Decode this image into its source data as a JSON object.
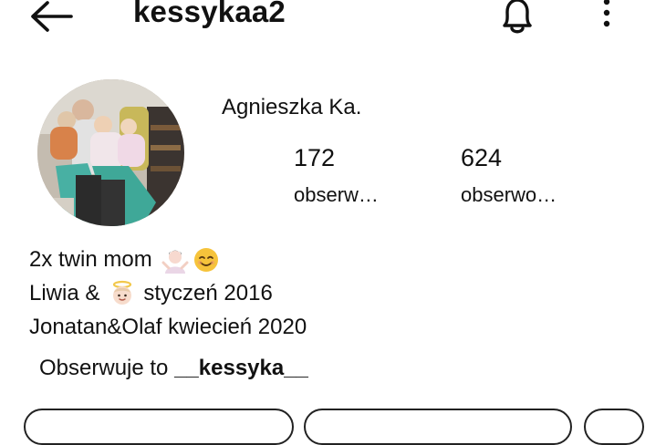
{
  "header": {
    "username": "kessykaa2"
  },
  "profile": {
    "display_name": "Agnieszka Ka.",
    "stats": [
      {
        "count": "172",
        "label": "obserw…"
      },
      {
        "count": "624",
        "label": "obserwo…"
      }
    ]
  },
  "bio": {
    "line1_text": "2x twin mom",
    "line2_before": "Liwia &",
    "line2_after": "styczeń 2016",
    "line3": "Jonatan&Olaf kwiecień 2020"
  },
  "followed_by": {
    "prefix": "Obserwuje to",
    "user": "__kessyka__"
  },
  "icons": {
    "back": "arrow-left-icon",
    "bell": "bell-icon",
    "more": "more-vertical-icon",
    "emoji1": "person-shrugging-emoji",
    "emoji2": "smiling-face-emoji",
    "emoji3": "baby-angel-emoji"
  },
  "colors": {
    "text": "#111111",
    "background": "#ffffff",
    "emoji_yellow": "#f6c33b"
  }
}
